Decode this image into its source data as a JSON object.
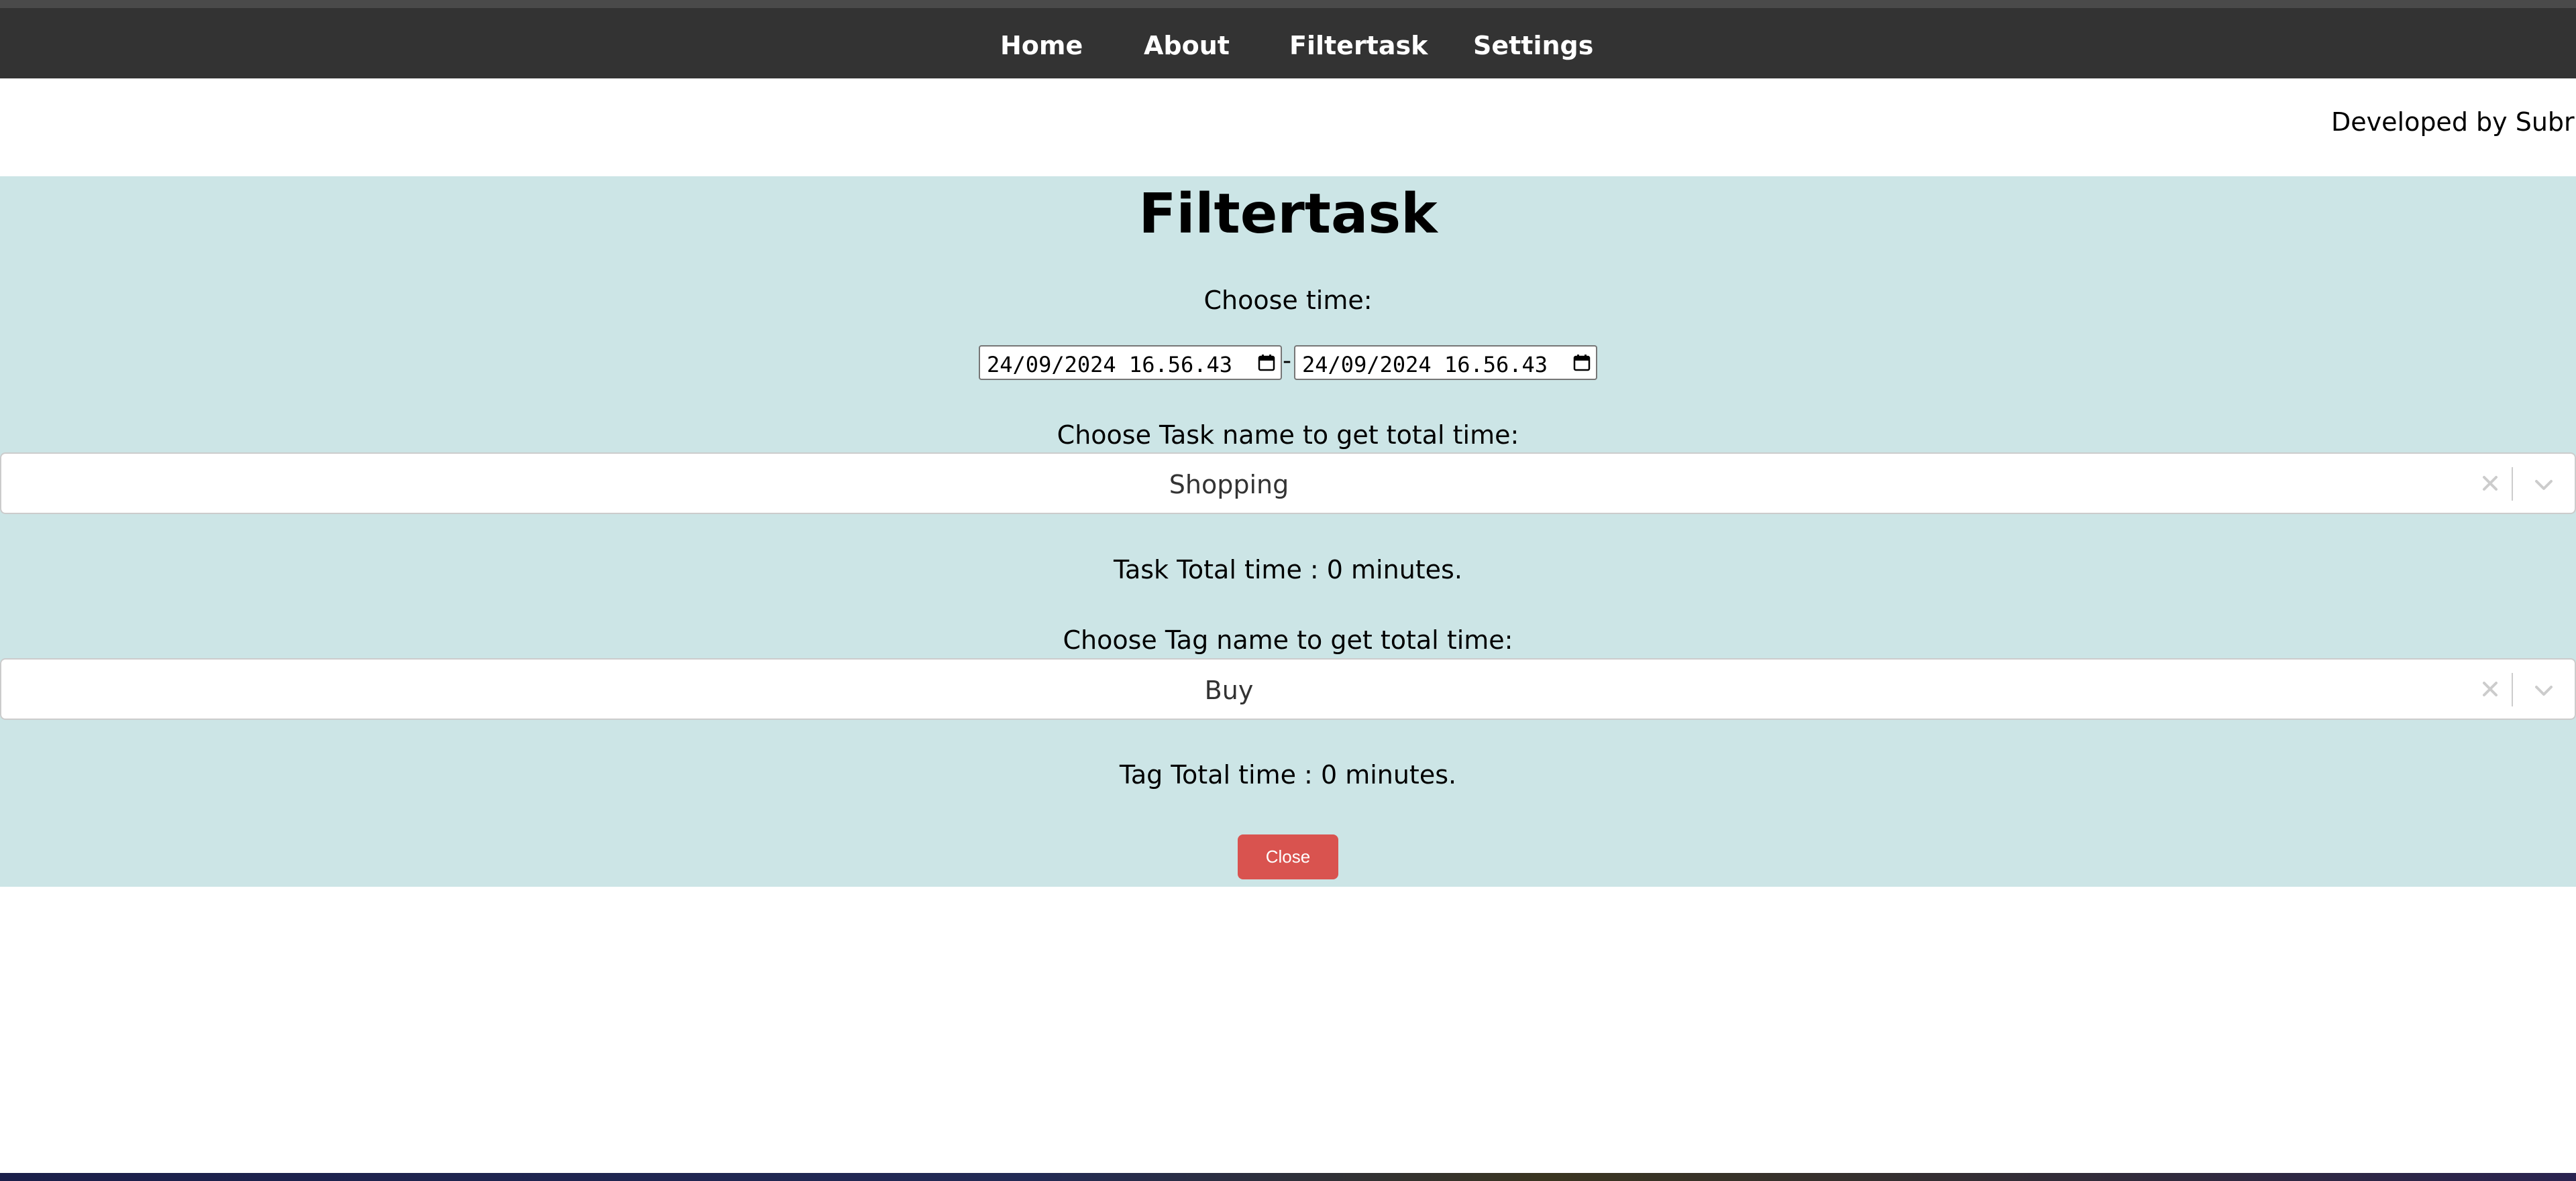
{
  "nav": {
    "items": [
      {
        "label": "Home"
      },
      {
        "label": "About"
      },
      {
        "label": "Filtertask"
      },
      {
        "label": "Settings"
      }
    ]
  },
  "header": {
    "credit": "Developed by Subria"
  },
  "main": {
    "title": "Filtertask",
    "time_label": "Choose time:",
    "start_datetime": "24/09/2024 16.56.43",
    "separator": "-",
    "end_datetime": "24/09/2024 16.56.43",
    "task_label": "Choose Task name to get total time:",
    "task_selected": "Shopping",
    "task_total": "Task Total time : 0 minutes.",
    "tag_label": "Choose Tag name to get total time:",
    "tag_selected": "Buy",
    "tag_total": "Tag Total time : 0 minutes.",
    "close_label": "Close"
  },
  "icons": {
    "calendar": "calendar-icon",
    "clear": "close-icon",
    "dropdown": "chevron-down-icon"
  },
  "colors": {
    "navbar": "#333333",
    "panel": "#cce5e6",
    "close_button": "#d9534f"
  }
}
